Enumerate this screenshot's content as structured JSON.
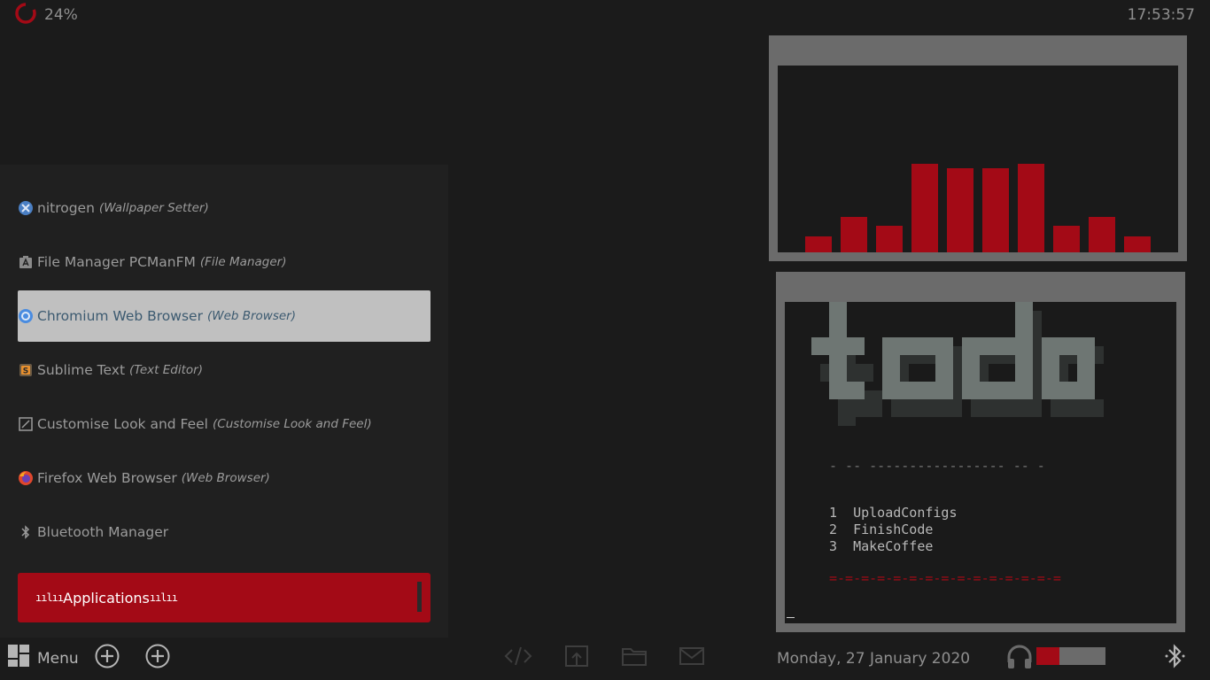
{
  "top_bar": {
    "cpu_usage_text": "24%",
    "cpu_usage_value": 24,
    "clock": "17:53:57"
  },
  "launcher": {
    "items": [
      {
        "name": "nitrogen",
        "category": "(Wallpaper Setter)",
        "icon": "nitrogen-icon"
      },
      {
        "name": "File Manager PCManFM",
        "category": "(File Manager)",
        "icon": "file-manager-icon"
      },
      {
        "name": "Chromium Web Browser",
        "category": "(Web Browser)",
        "icon": "chromium-icon",
        "selected": true
      },
      {
        "name": "Sublime Text",
        "category": "(Text Editor)",
        "icon": "sublime-text-icon"
      },
      {
        "name": "Customise Look and Feel",
        "category": "(Customise Look and Feel)",
        "icon": "appearance-icon"
      },
      {
        "name": "Firefox Web Browser",
        "category": "(Web Browser)",
        "icon": "firefox-icon"
      },
      {
        "name": "Bluetooth Manager",
        "category": "",
        "icon": "bluetooth-icon"
      }
    ],
    "category_label": "Applications"
  },
  "visualizer": {
    "levels": [
      0.18,
      0.4,
      0.3,
      1.0,
      0.95,
      0.95,
      1.0,
      0.3,
      0.4,
      0.18
    ]
  },
  "todo": {
    "separator_top": "- -- ----------------- -- -",
    "items": [
      {
        "num": "1",
        "text": "UploadConfigs"
      },
      {
        "num": "2",
        "text": "FinishCode"
      },
      {
        "num": "3",
        "text": "MakeCoffee"
      }
    ],
    "separator_bottom": "=-=-=-=-=-=-=-=-=-=-=-=-=-=-="
  },
  "taskbar": {
    "menu_label": "Menu",
    "date": "Monday, 27 January 2020",
    "volume_level": 0.33
  },
  "colors": {
    "accent": "#a30a16",
    "background": "#1b1b1b",
    "panel": "#202020",
    "frame": "#6b6b6b"
  }
}
